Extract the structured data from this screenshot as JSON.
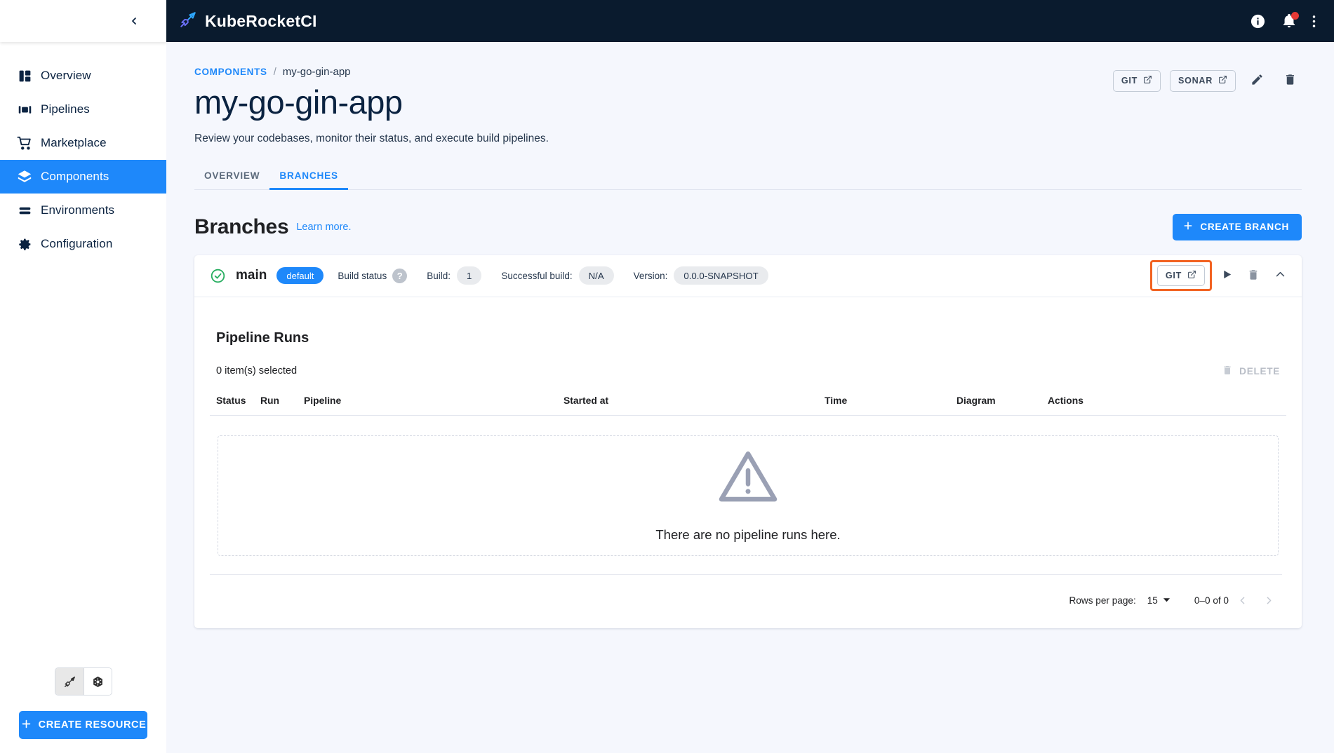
{
  "sidebar": {
    "collapse_icon": "chevron-left-icon",
    "items": [
      {
        "label": "Overview",
        "icon": "dashboard-icon",
        "active": false
      },
      {
        "label": "Pipelines",
        "icon": "pipelines-icon",
        "active": false
      },
      {
        "label": "Marketplace",
        "icon": "cart-icon",
        "active": false
      },
      {
        "label": "Components",
        "icon": "layers-icon",
        "active": true
      },
      {
        "label": "Environments",
        "icon": "stack-lines-icon",
        "active": false
      },
      {
        "label": "Configuration",
        "icon": "gear-icon",
        "active": false
      }
    ],
    "view_toggle": [
      {
        "icon": "kuberocket-rocket-icon",
        "selected": true
      },
      {
        "icon": "kubernetes-helm-icon",
        "selected": false
      }
    ],
    "create_resource_label": "CREATE RESOURCE",
    "create_resource_icon": "plus-icon"
  },
  "topbar": {
    "brand": "KubeRocketCI",
    "brand_icon": "rocket-logo-icon",
    "icons": [
      {
        "name": "info-icon",
        "badge": false
      },
      {
        "name": "bell-icon",
        "badge": true
      },
      {
        "name": "kebab-menu-icon",
        "badge": false
      }
    ]
  },
  "breadcrumb": {
    "root": "COMPONENTS",
    "separator": "/",
    "current": "my-go-gin-app"
  },
  "page": {
    "title": "my-go-gin-app",
    "subtitle": "Review your codebases, monitor their status, and execute build pipelines."
  },
  "header_actions": {
    "git_label": "GIT",
    "sonar_label": "SONAR",
    "external_icon": "external-link-icon",
    "edit_icon": "pencil-icon",
    "delete_icon": "trash-icon"
  },
  "tabs": [
    {
      "label": "OVERVIEW",
      "active": false
    },
    {
      "label": "BRANCHES",
      "active": true
    }
  ],
  "branches_section": {
    "title": "Branches",
    "learn_more": "Learn more.",
    "create_branch_label": "CREATE BRANCH",
    "create_branch_icon": "plus-icon"
  },
  "branch": {
    "status_icon": "check-circle-icon",
    "name": "main",
    "default_chip": "default",
    "build_status_label": "Build status",
    "build_status_help": "?",
    "build_label": "Build:",
    "build_value": "1",
    "successful_build_label": "Successful build:",
    "successful_build_value": "N/A",
    "version_label": "Version:",
    "version_value": "0.0.0-SNAPSHOT",
    "actions": {
      "git_label": "GIT",
      "git_external_icon": "external-link-icon",
      "run_icon": "play-icon",
      "delete_icon": "trash-icon",
      "collapse_icon": "chevron-up-icon"
    }
  },
  "pipeline_runs": {
    "title": "Pipeline Runs",
    "selected_text": "0 item(s) selected",
    "delete_label": "DELETE",
    "delete_icon": "trash-icon",
    "columns": [
      "Status",
      "Run",
      "Pipeline",
      "Started at",
      "Time",
      "Diagram",
      "Actions"
    ],
    "rows": [],
    "empty_icon": "warning-triangle-icon",
    "empty_text": "There are no pipeline runs here.",
    "pagination": {
      "rows_per_page_label": "Rows per page:",
      "rows_per_page_value": "15",
      "dropdown_icon": "caret-down-icon",
      "range_text": "0–0 of 0",
      "prev_icon": "chevron-left-icon",
      "next_icon": "chevron-right-icon"
    }
  },
  "colors": {
    "accent_blue": "#1e88fa",
    "topbar_navy": "#0a1b2e",
    "page_bg": "#f5f7fd",
    "success_green": "#27ae60",
    "highlight_orange": "#f26322",
    "badge_red": "#e53935"
  }
}
